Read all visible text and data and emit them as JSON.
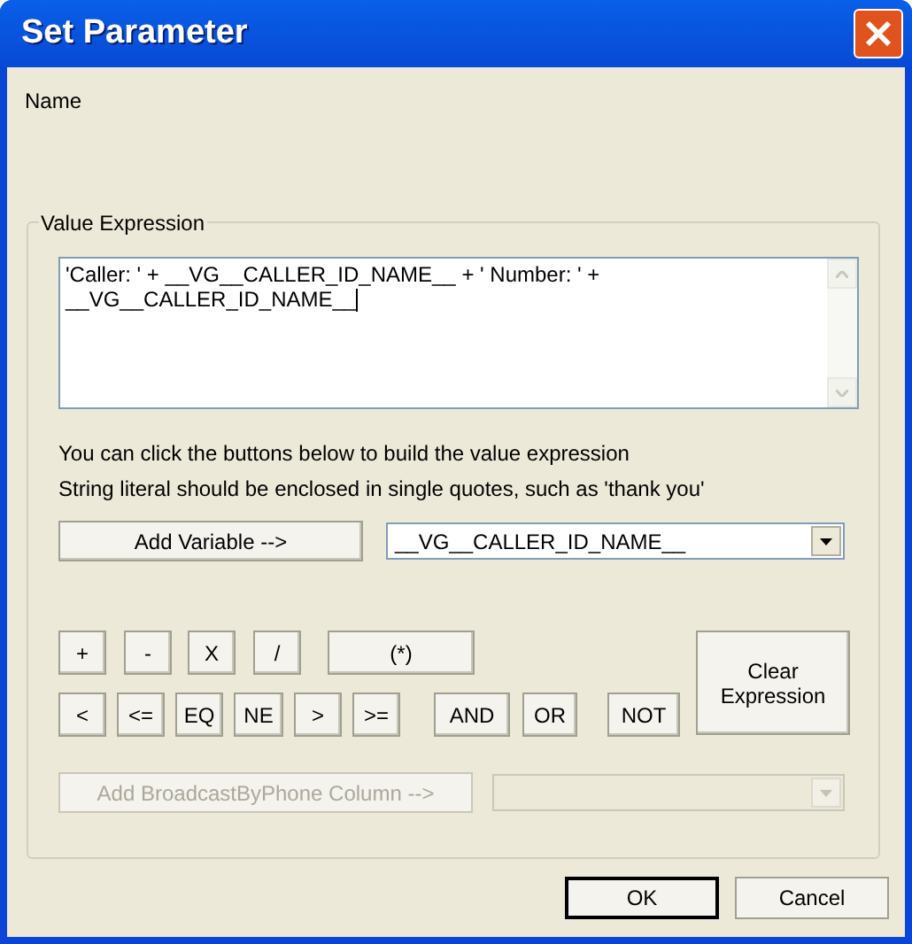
{
  "window": {
    "title": "Set Parameter"
  },
  "name_label": "Name",
  "value_expression": {
    "legend": "Value Expression",
    "expression": "'Caller: ' + __VG__CALLER_ID_NAME__ + ' Number: ' + __VG__CALLER_ID_NAME__",
    "hints": [
      "You can click the buttons below to build the value expression",
      "String literal should be enclosed in single quotes, such as 'thank you'"
    ],
    "add_variable_button": {
      "label": "Add Variable -->",
      "disabled": false
    },
    "variable_combo": {
      "value": "__VG__CALLER_ID_NAME__",
      "disabled": false
    },
    "operator_rows": [
      [
        "+",
        "-",
        "X",
        "/",
        "(*)"
      ],
      [
        "<",
        "<=",
        "EQ",
        "NE",
        ">",
        ">=",
        "AND",
        "OR",
        "NOT"
      ]
    ],
    "clear_button": {
      "label": "Clear Expression"
    },
    "add_column_button": {
      "label": "Add BroadcastByPhone Column -->",
      "disabled": true
    },
    "column_combo": {
      "disabled": true
    }
  },
  "buttons": [
    {
      "label": "OK",
      "default": true
    },
    {
      "label": "Cancel",
      "default": false
    }
  ]
}
